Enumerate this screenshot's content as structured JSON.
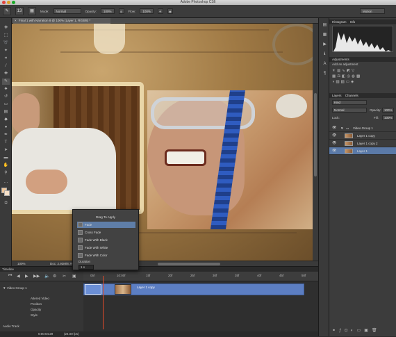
{
  "app": {
    "title": "Adobe Photoshop CS6"
  },
  "options": {
    "mode_label": "Mode:",
    "mode_value": "Normal",
    "opacity_label": "Opacity:",
    "opacity_value": "100%",
    "flow_label": "Flow:",
    "flow_value": "100%",
    "brush_size": "13",
    "workspace": "Motion"
  },
  "document": {
    "tab_title": "Final 1 with Narration 8 @ 100% (Layer 1, RGB/8) *",
    "zoom": "100%",
    "doc_info": "Doc: 2.93M/8.7M"
  },
  "popup": {
    "header": "Drag To Apply",
    "items": [
      "Fade",
      "Cross Fade",
      "Fade With Black",
      "Fade With White",
      "Fade With Color"
    ],
    "duration_label": "Duration",
    "duration_value": "1 s"
  },
  "timeline": {
    "panel_title": "Timeline",
    "ruler": [
      "05f",
      "10:00f",
      "15f",
      "20f",
      "25f",
      "30f",
      "35f",
      "40f",
      "45f",
      "50f"
    ],
    "group_name": "Video Group 1",
    "clip_label": "Layer 1 copy",
    "properties": [
      "Altered Video",
      "Position",
      "Opacity",
      "Style"
    ],
    "audio_track": "Audio Track",
    "timecode": "0:00:04:29",
    "fps": "(24.00 fps)"
  },
  "panels": {
    "histogram_tab": "Histogram",
    "info_tab": "Info",
    "adjustments_tab": "Adjustments",
    "add_adjustment": "Add an adjustment",
    "layers_tab": "Layers",
    "channels_tab": "Channels",
    "kind_value": "Kind",
    "blend_value": "Normal",
    "opacity_label": "Opacity:",
    "opacity_value": "100%",
    "lock_label": "Lock:",
    "fill_label": "Fill:",
    "fill_value": "100%",
    "layers": [
      "Video Group 1",
      "Layer 1 copy",
      "Layer 1 copy 2",
      "Layer 1"
    ]
  }
}
